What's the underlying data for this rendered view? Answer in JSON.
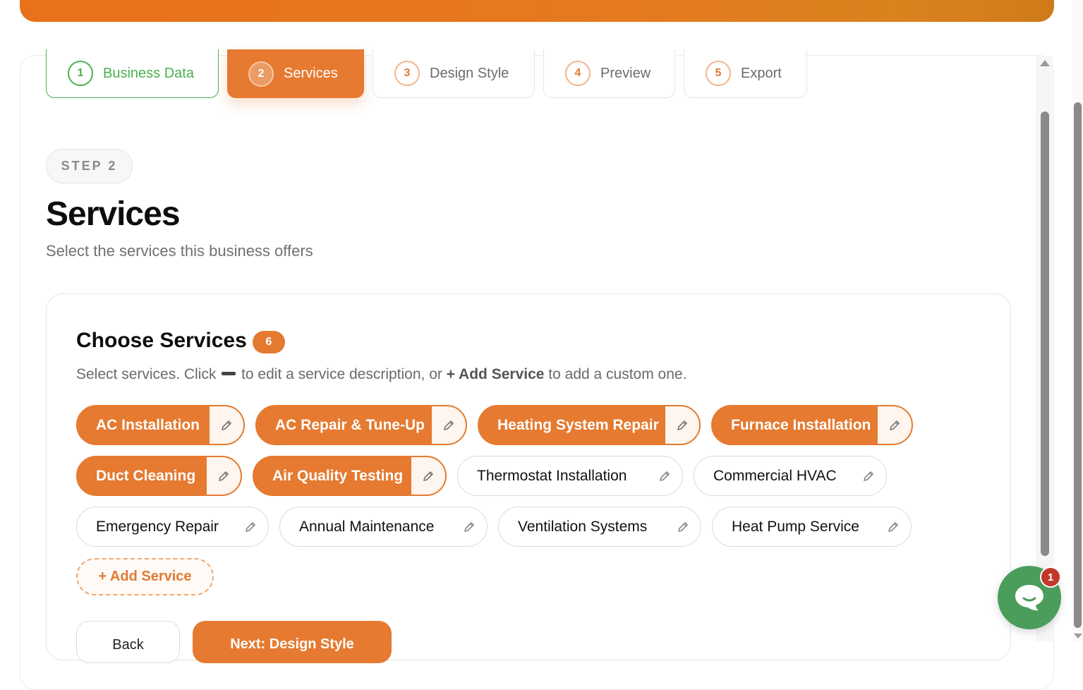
{
  "colors": {
    "accent": "#e57a30",
    "success": "#4caf50",
    "chat": "#4a9d5b",
    "badge": "#c0392b"
  },
  "steps": [
    {
      "num": "1",
      "label": "Business Data",
      "state": "done"
    },
    {
      "num": "2",
      "label": "Services",
      "state": "active"
    },
    {
      "num": "3",
      "label": "Design Style",
      "state": "pending"
    },
    {
      "num": "4",
      "label": "Preview",
      "state": "pending"
    },
    {
      "num": "5",
      "label": "Export",
      "state": "pending"
    }
  ],
  "step_pill": "STEP 2",
  "page": {
    "title": "Services",
    "subtitle": "Select the services this business offers"
  },
  "panel": {
    "title": "Choose Services",
    "count": "6",
    "help_prefix": "Select services. Click",
    "help_mid": "to edit a service description, or",
    "help_add": "+ Add Service",
    "help_suffix": "to add a custom one."
  },
  "services": [
    {
      "label": "AC Installation",
      "selected": true
    },
    {
      "label": "AC Repair & Tune-Up",
      "selected": true
    },
    {
      "label": "Heating System Repair",
      "selected": true
    },
    {
      "label": "Furnace Installation",
      "selected": true
    },
    {
      "label": "Duct Cleaning",
      "selected": true
    },
    {
      "label": "Air Quality Testing",
      "selected": true
    },
    {
      "label": "Thermostat Installation",
      "selected": false
    },
    {
      "label": "Commercial HVAC",
      "selected": false
    },
    {
      "label": "Emergency Repair",
      "selected": false
    },
    {
      "label": "Annual Maintenance",
      "selected": false
    },
    {
      "label": "Ventilation Systems",
      "selected": false
    },
    {
      "label": "Heat Pump Service",
      "selected": false
    }
  ],
  "add_service_label": "+ Add Service",
  "buttons": {
    "back": "Back",
    "next": "Next: Design Style"
  },
  "chat": {
    "icon": "chat-icon",
    "badge": "1"
  }
}
